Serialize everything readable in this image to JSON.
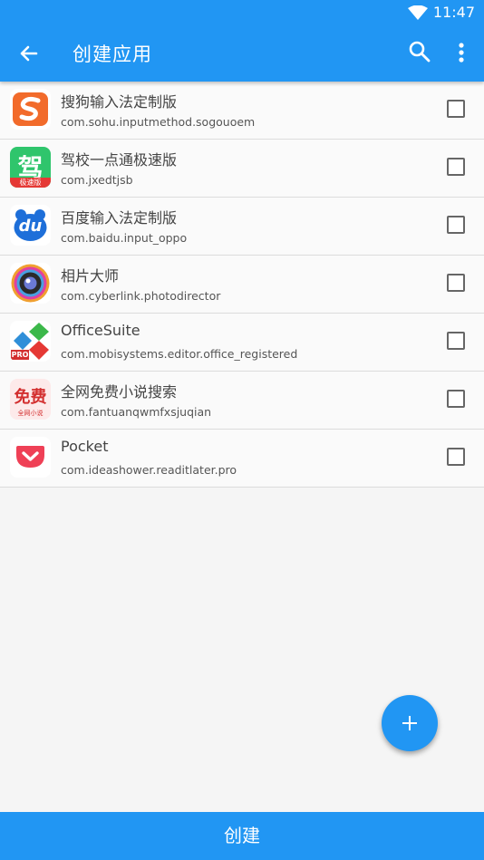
{
  "status": {
    "time": "11:47"
  },
  "toolbar": {
    "title": "创建应用"
  },
  "apps": [
    {
      "name": "搜狗输入法定制版",
      "package": "com.sohu.inputmethod.sogouoem",
      "icon": "sogou-icon",
      "checked": false
    },
    {
      "name": "驾校一点通极速版",
      "package": "com.jxedtjsb",
      "icon": "jiaxiao-icon",
      "checked": false
    },
    {
      "name": "百度输入法定制版",
      "package": "com.baidu.input_oppo",
      "icon": "baidu-input-icon",
      "checked": false
    },
    {
      "name": "相片大师",
      "package": "com.cyberlink.photodirector",
      "icon": "photodirector-icon",
      "checked": false
    },
    {
      "name": "OfficeSuite",
      "package": "com.mobisystems.editor.office_registered",
      "icon": "officesuite-icon",
      "checked": false
    },
    {
      "name": "全网免费小说搜索",
      "package": "com.fantuanqwmfxsjuqian",
      "icon": "novel-search-icon",
      "checked": false
    },
    {
      "name": "Pocket",
      "package": "com.ideashower.readitlater.pro",
      "icon": "pocket-icon",
      "checked": false
    }
  ],
  "icon_text": {
    "jiaxiao_main": "驾",
    "jiaxiao_tag": "极速版",
    "baidu_text": "du",
    "office_tag": "PRO",
    "novel_main": "免费",
    "novel_tag": "全网小说"
  },
  "bottom": {
    "create_label": "创建"
  },
  "colors": {
    "primary": "#2196f3"
  }
}
